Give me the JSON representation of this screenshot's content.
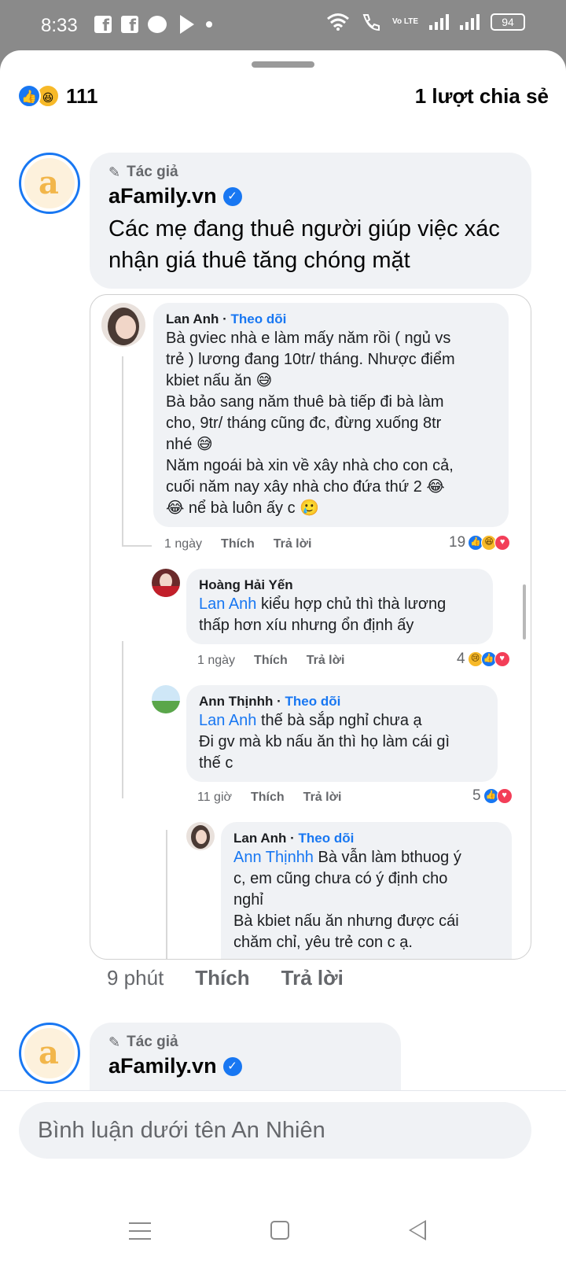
{
  "status_bar": {
    "time": "8:33",
    "battery": "94",
    "volte": "Vo LTE",
    "icons_left": [
      "facebook-icon",
      "facebook-icon",
      "messenger-icon",
      "telegram-icon",
      "dot-icon"
    ],
    "icons_right": [
      "wifi-icon",
      "wifi-call-icon",
      "volte-icon",
      "signal-icon",
      "signal-icon",
      "battery-icon"
    ]
  },
  "reactions_bar": {
    "count": "111",
    "shares": "1 lượt chia sẻ"
  },
  "post": {
    "author_tag": "Tác giả",
    "author_name": "aFamily.vn",
    "text": "Các mẹ đang thuê người giúp việc xác nhận giá thuê tăng chóng mặt",
    "time": "9 phút",
    "like_label": "Thích",
    "reply_label": "Trả lời"
  },
  "embedded_comments": [
    {
      "name": "Lan Anh",
      "follow": "Theo dõi",
      "lines": [
        "Bà gviec nhà e làm mấy năm rồi ( ngủ vs",
        "trẻ ) lương đang 10tr/ tháng. Nhược điểm",
        "kbiet nấu ăn 😅",
        "Bà bảo sang năm thuê bà tiếp đi bà làm",
        "cho, 9tr/ tháng cũng đc, đừng xuống 8tr",
        "nhé 😅",
        "Năm ngoái bà xin về xây nhà cho con cả,",
        "cuối năm nay xây nhà cho đứa thứ 2 😂",
        "😂 nể bà luôn ấy c 🥲"
      ],
      "time": "1 ngày",
      "like": "Thích",
      "reply": "Trả lời",
      "reaction_count": "19"
    },
    {
      "name": "Hoàng Hải Yến",
      "mention": "Lan Anh",
      "lines": [
        " kiểu hợp chủ thì thà lương",
        "thấp hơn xíu nhưng ổn định ấy"
      ],
      "time": "1 ngày",
      "like": "Thích",
      "reply": "Trả lời",
      "reaction_count": "4"
    },
    {
      "name": "Ann Thịnhh",
      "follow": "Theo dõi",
      "mention": "Lan Anh",
      "lines": [
        " thế bà sắp nghỉ chưa ạ",
        "Đi gv mà kb nấu ăn thì họ làm cái gì",
        "thế c"
      ],
      "time": "11 giờ",
      "like": "Thích",
      "reply": "Trả lời",
      "reaction_count": "5"
    },
    {
      "name": "Lan Anh",
      "follow": "Theo dõi",
      "mention": "Ann Thịnhh",
      "lines": [
        " Bà vẫn làm bthuog ý",
        "c, em cũng chưa có ý định cho",
        "nghỉ",
        "Bà kbiet nấu ăn nhưng được cái",
        "chăm chỉ, yêu trẻ con c ạ."
      ]
    }
  ],
  "second_post": {
    "author_tag": "Tác giả",
    "author_name": "aFamily.vn"
  },
  "composer": {
    "placeholder": "Bình luận dưới tên An Nhiên"
  },
  "colors": {
    "accent": "#1877f2",
    "bubble": "#f0f2f5",
    "muted": "#65676b"
  }
}
